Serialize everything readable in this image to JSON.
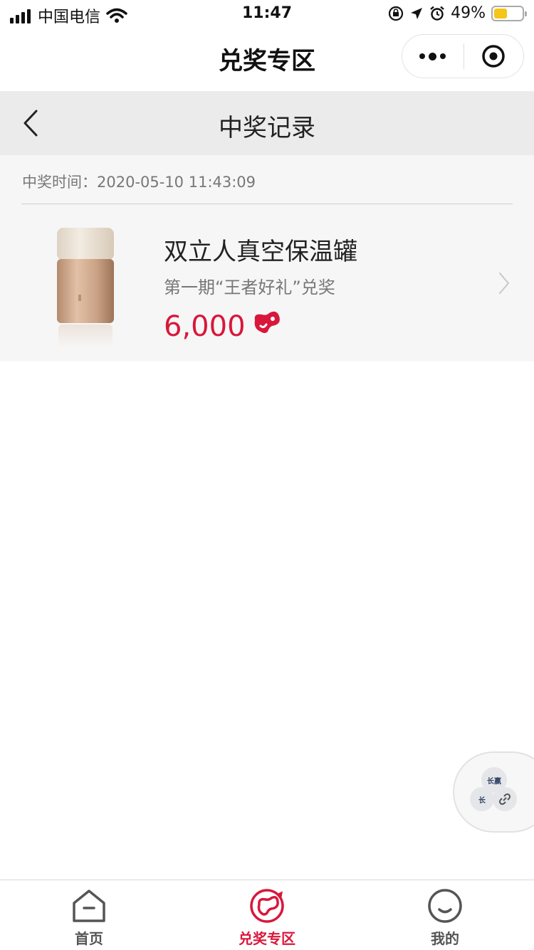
{
  "status_bar": {
    "carrier": "中国电信",
    "time": "11:47",
    "battery": "49%",
    "battery_level": 0.49
  },
  "mini_program": {
    "title": "兑奖专区",
    "more_icon": "more-dots-icon",
    "close_icon": "target-close-icon"
  },
  "header": {
    "back_icon": "chevron-left-icon",
    "title": "中奖记录"
  },
  "records": [
    {
      "time_label": "中奖时间：2020-05-10 11:43:09",
      "name": "双立人真空保温罐",
      "subtitle": "第一期“王者好礼”兑奖",
      "price": "6,000",
      "price_icon": "red-bean-icon",
      "arrow_icon": "chevron-right-icon"
    }
  ],
  "floating_widget": {
    "label_1": "长赢",
    "label_2": "长",
    "link_icon": "link-icon"
  },
  "tab_bar": {
    "tabs": [
      {
        "label": "首页",
        "icon": "home-icon",
        "active": false
      },
      {
        "label": "兑奖专区",
        "icon": "redeem-bean-icon",
        "active": true
      },
      {
        "label": "我的",
        "icon": "smile-face-icon",
        "active": false
      }
    ]
  },
  "colors": {
    "accent": "#d9173b",
    "header_bg": "#ebebeb",
    "card_bg": "#f6f6f6"
  }
}
